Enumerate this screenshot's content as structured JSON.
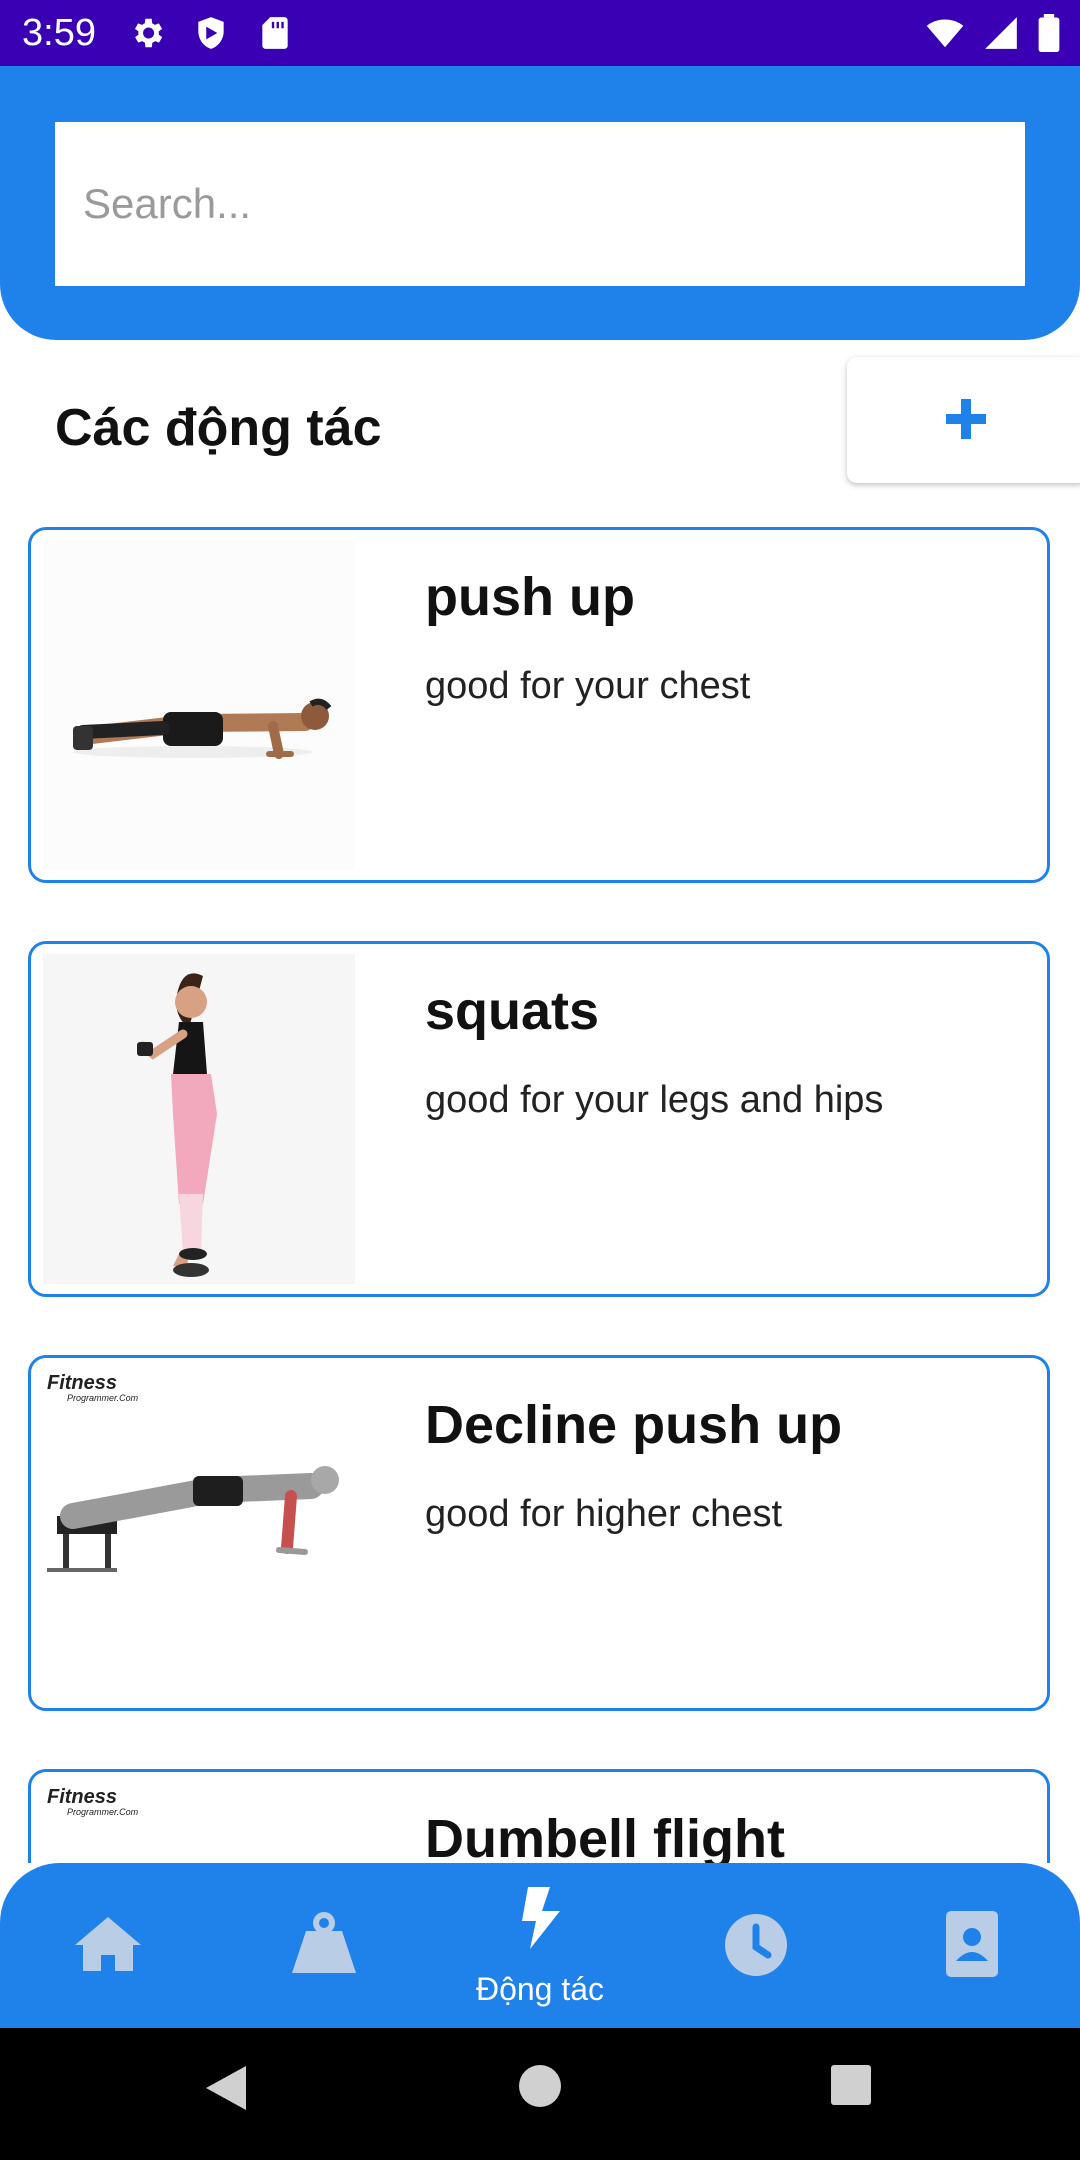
{
  "status_bar": {
    "time": "3:59",
    "left_icons": [
      "gear-icon",
      "shield-icon",
      "sd-card-icon"
    ],
    "right_icons": [
      "wifi-icon",
      "signal-icon",
      "battery-icon"
    ]
  },
  "search": {
    "placeholder": "Search...",
    "value": ""
  },
  "section": {
    "title": "Các động tác",
    "add_icon": "plus-icon"
  },
  "exercises": [
    {
      "title": "push up",
      "description": "good for your chest",
      "image": "push-up-photo"
    },
    {
      "title": "squats",
      "description": "good for your legs and hips",
      "image": "squat-photo"
    },
    {
      "title": "Decline push up",
      "description": "good for higher chest",
      "image": "decline-push-up-illustration",
      "logo": "Fitness",
      "logo_sub": "Programmer.Com"
    },
    {
      "title": "Dumbell flight",
      "description": "",
      "image": "dumbbell-fly-illustration",
      "logo": "Fitness",
      "logo_sub": "Programmer.Com"
    }
  ],
  "bottom_nav": {
    "items": [
      {
        "icon": "home-icon",
        "label": ""
      },
      {
        "icon": "weight-icon",
        "label": ""
      },
      {
        "icon": "bolt-icon",
        "label": "Động tác",
        "active": true
      },
      {
        "icon": "clock-icon",
        "label": ""
      },
      {
        "icon": "contact-icon",
        "label": ""
      }
    ]
  },
  "colors": {
    "primary": "#1e82ea",
    "status_bar": "#3a00b3",
    "nav_inactive": "#b9cde6"
  }
}
